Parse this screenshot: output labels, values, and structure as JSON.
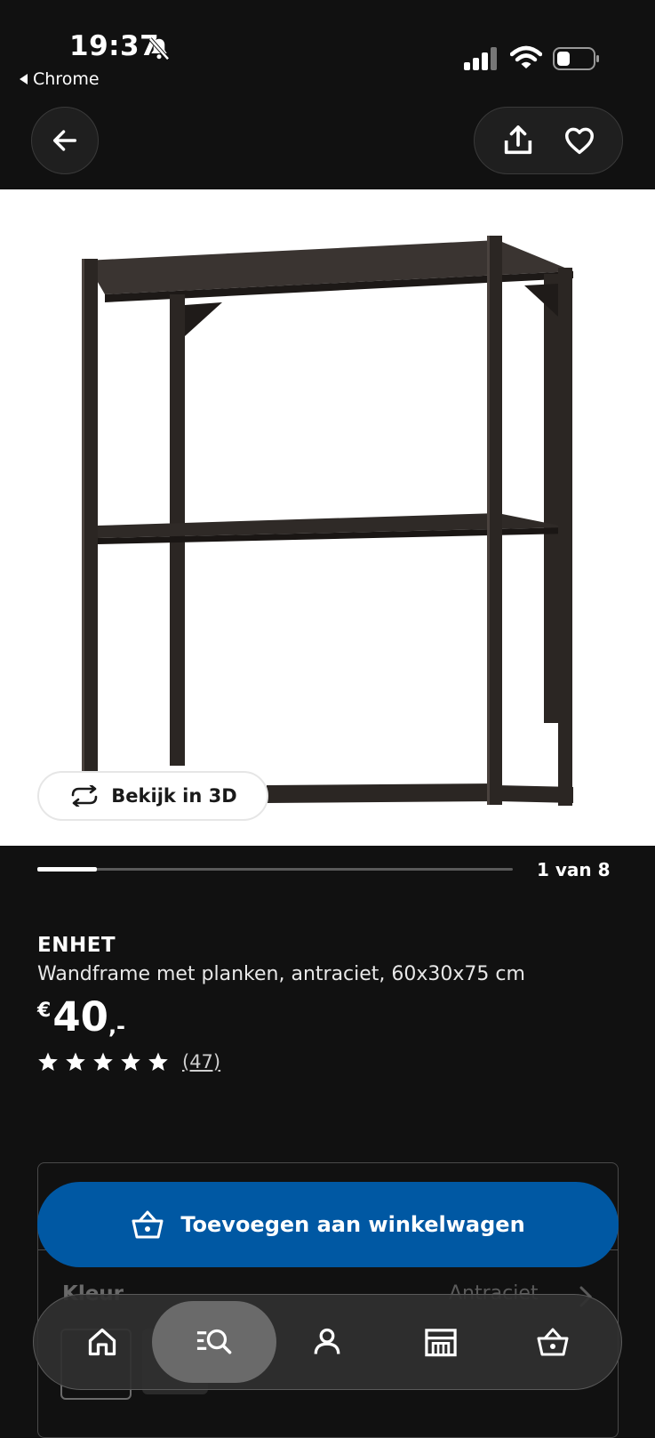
{
  "status_bar": {
    "time": "19:37",
    "back_app": "Chrome",
    "icons": [
      "bell-slash-icon",
      "cellular-signal-icon",
      "wifi-icon",
      "battery-icon"
    ]
  },
  "header": {
    "icons": [
      "arrow-left-icon",
      "share-icon",
      "heart-icon"
    ]
  },
  "gallery": {
    "view_3d_label": "Bekijk in 3D",
    "counter": "1 van 8",
    "progress": 0.125
  },
  "product": {
    "brand": "ENHET",
    "description": "Wandframe met planken, antraciet, 60x30x75 cm",
    "price_currency": "€",
    "price_amount": "40",
    "price_suffix": ",-",
    "rating": 5,
    "review_count": "(47)"
  },
  "cart": {
    "add_label": "Toevoegen aan winkelwagen"
  },
  "options": {
    "colour_label": "Kleur",
    "colour_value": "Antraciet"
  },
  "bottom_nav": {
    "items": [
      "home-icon",
      "search-icon",
      "profile-icon",
      "store-icon",
      "cart-icon"
    ],
    "active": "search-icon"
  },
  "colors": {
    "background": "#111111",
    "accent_blue": "#0058a3",
    "frame": "#2b2623"
  }
}
